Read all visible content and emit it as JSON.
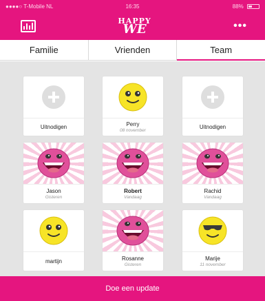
{
  "status_bar": {
    "carrier": "●●●●○ T-Mobile NL",
    "time": "16:35",
    "battery": "88%"
  },
  "nav": {
    "left_icon": "bar-chart-icon",
    "logo_line1": "HAPPY",
    "logo_line2": "WE",
    "menu_icon": "more-dots-icon",
    "menu_label": "•••"
  },
  "tabs": [
    {
      "label": "Familie",
      "active": false
    },
    {
      "label": "Vrienden",
      "active": false
    },
    {
      "label": "Team",
      "active": true
    }
  ],
  "cards": [
    {
      "name": "Uitnodigen",
      "sub": "",
      "type": "invite"
    },
    {
      "name": "Perry",
      "sub": "08 november",
      "type": "smiley-yellow-grin"
    },
    {
      "name": "Uitnodigen",
      "sub": "",
      "type": "invite"
    },
    {
      "name": "Jason",
      "sub": "Gisteren",
      "type": "smiley-pink-laugh"
    },
    {
      "name": "Robert",
      "sub": "Vandaag",
      "type": "smiley-pink-laugh"
    },
    {
      "name": "Rachid",
      "sub": "Vandaag",
      "type": "smiley-pink-laugh"
    },
    {
      "name": "martijn",
      "sub": "",
      "type": "smiley-yellow-grin"
    },
    {
      "name": "Rosanne",
      "sub": "Gisteren",
      "type": "smiley-pink-laugh"
    },
    {
      "name": "Marije",
      "sub": "11 november",
      "type": "smiley-yellow-cool"
    }
  ],
  "colors": {
    "brand_pink": "#e5157f",
    "smiley_yellow": "#f7e427",
    "smiley_pink": "#e0509a"
  },
  "footer": {
    "update_label": "Doe een update"
  }
}
